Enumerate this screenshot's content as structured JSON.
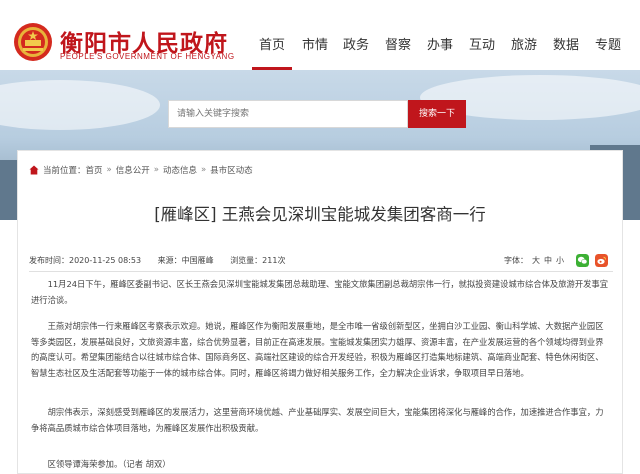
{
  "header": {
    "site_title": "衡阳市人民政府",
    "site_subtitle": "PEOPLE'S GOVERNMENT OF HENGYANG",
    "nav": [
      "首页",
      "市情",
      "政务",
      "督察",
      "办事",
      "互动",
      "旅游",
      "数据",
      "专题"
    ],
    "active_nav": "首页"
  },
  "search": {
    "placeholder": "请输入关键字搜索",
    "button_label": "搜索一下"
  },
  "breadcrumb": {
    "prefix": "当前位置：",
    "items": [
      "首页",
      "信息公开",
      "动态信息",
      "县市区动态"
    ]
  },
  "article": {
    "title": "[雁峰区] 王燕会见深圳宝能城发集团客商一行",
    "publish_time": "发布时间：2020-11-25 08:53",
    "source": "来源：中国雁峰",
    "views": "浏览量：211次",
    "font_label": "字体：",
    "font_sizes": [
      "大",
      "中",
      "小"
    ],
    "paragraphs": [
      "11月24日下午，雁峰区委副书记、区长王燕会见深圳宝能城发集团总裁助理、宝能文旅集团副总裁胡宗伟一行，就拟投资建设城市综合体及旅游开发事宜进行洽谈。",
      "王燕对胡宗伟一行来雁峰区考察表示欢迎。她说，雁峰区作为衡阳发展重地，是全市唯一省级创新型区，坐拥白沙工业园、衡山科学城、大数据产业园区等多类园区，发展基础良好，文旅资源丰富，综合优势显著，目前正在高速发展。宝能城发集团实力雄厚、资源丰富，在产业发展运营的各个领域均得到业界的高度认可。希望集团能结合以往城市综合体、国际商务区、高端社区建设的综合开发经验，积极为雁峰区打造集地标建筑、高端商业配套、特色休闲街区、智慧生态社区及生活配套等功能于一体的城市综合体。同时，雁峰区将竭力做好相关服务工作，全力解决企业诉求，争取项目早日落地。",
      "胡宗伟表示，深刻感受到雁峰区的发展活力，这里营商环境优越、产业基础厚实、发展空间巨大，宝能集团将深化与雁峰的合作，加速推进合作事宜，力争将高品质城市综合体项目落地，为雁峰区发展作出积极贡献。",
      "区领导谭海荣参加。（记者 胡双）"
    ]
  },
  "colors": {
    "brand_red": "#c0161c",
    "wechat_green": "#3cb034",
    "weibo_orange": "#e8532a"
  },
  "icons": [
    "emblem-logo",
    "home-icon",
    "wechat-share-icon",
    "weibo-share-icon"
  ]
}
